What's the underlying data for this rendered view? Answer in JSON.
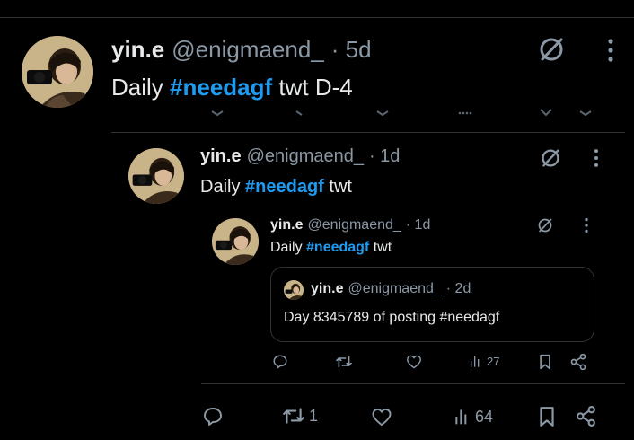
{
  "main_post": {
    "name": "yin.e",
    "handle": "@enigmaend_",
    "time": "· 5d",
    "text_prefix": "Daily ",
    "hashtag": "#needagf",
    "text_suffix": " twt D-4"
  },
  "quote_1": {
    "name": "yin.e",
    "handle": "@enigmaend_",
    "time": "· 1d",
    "text_prefix": "Daily ",
    "hashtag": "#needagf",
    "text_suffix": " twt"
  },
  "quote_2": {
    "name": "yin.e",
    "handle": "@enigmaend_",
    "time": "· 1d",
    "text_prefix": "Daily ",
    "hashtag": "#needagf",
    "text_suffix": " twt",
    "actions": {
      "reposts": "",
      "views": "27"
    }
  },
  "quote_3": {
    "name": "yin.e",
    "handle": "@enigmaend_",
    "time": "· 2d",
    "text": "Day 8345789 of posting #needagf"
  },
  "main_actions": {
    "reposts": "1",
    "views": "64"
  },
  "colors": {
    "background": "#000000",
    "text": "#e7e9ea",
    "secondary": "#8b98a5",
    "hashtag": "#1d9bf0",
    "border": "#2f3336"
  },
  "icons": [
    "grok-icon",
    "more-icon",
    "reply-icon",
    "repost-icon",
    "like-icon",
    "views-icon",
    "bookmark-icon",
    "share-icon"
  ]
}
